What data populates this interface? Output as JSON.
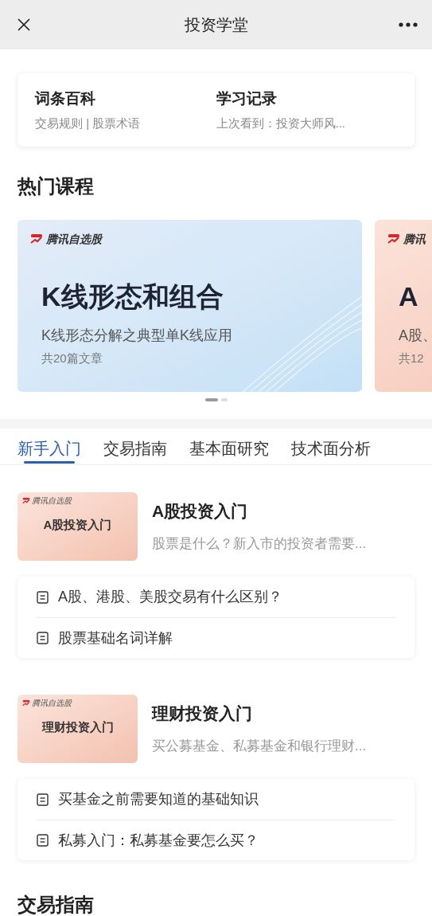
{
  "header": {
    "title": "投资学堂"
  },
  "shortcuts": [
    {
      "title": "词条百科",
      "subtitle": "交易规则 | 股票术语"
    },
    {
      "title": "学习记录",
      "subtitle": "上次看到：投资大师风..."
    }
  ],
  "section_title": "热门课程",
  "carousel": {
    "cards": [
      {
        "kind": "blue",
        "brand": "腾讯自选股",
        "title": "K线形态和组合",
        "subtitle": "K线形态分解之典型单K线应用",
        "count": "共20篇文章"
      },
      {
        "kind": "peach",
        "brand": "腾讯",
        "title": "A",
        "subtitle": "A股、",
        "count": "共12"
      }
    ],
    "dots": [
      {
        "selected": true
      },
      {
        "selected": false
      }
    ]
  },
  "tabs": [
    {
      "label": "新手入门",
      "selected": true
    },
    {
      "label": "交易指南",
      "selected": false
    },
    {
      "label": "基本面研究",
      "selected": false
    },
    {
      "label": "技术面分析",
      "selected": false
    }
  ],
  "courses": [
    {
      "thumb_brand": "腾讯自选股",
      "thumb_title": "A股投资入门",
      "title": "A股投资入门",
      "description": "股票是什么？新入市的投资者需要...",
      "articles": [
        "A股、港股、美股交易有什么区别？",
        "股票基础名词详解"
      ]
    },
    {
      "thumb_brand": "腾讯自选股",
      "thumb_title": "理财投资入门",
      "title": "理财投资入门",
      "description": "买公募基金、私募基金和银行理财...",
      "articles": [
        "买基金之前需要知道的基础知识",
        "私募入门：私募基金要怎么买？"
      ]
    }
  ],
  "next_section_title": "交易指南"
}
